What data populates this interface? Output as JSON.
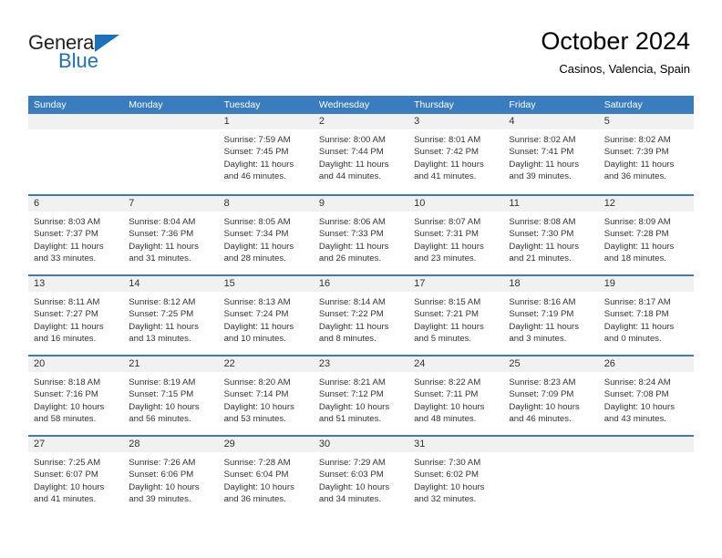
{
  "brand": {
    "name_top": "General",
    "name_bottom": "Blue",
    "triangle_icon": "triangle-icon",
    "color_primary": "#1b72b8",
    "color_text": "#231f20"
  },
  "header": {
    "title": "October 2024",
    "subtitle": "Casinos, Valencia, Spain"
  },
  "calendar": {
    "header_bg": "#3a7dbf",
    "cell_strip_bg": "#f1f1f1",
    "weekdays": [
      "Sunday",
      "Monday",
      "Tuesday",
      "Wednesday",
      "Thursday",
      "Friday",
      "Saturday"
    ],
    "weeks": [
      [
        {
          "day": "",
          "sunrise": "",
          "sunset": "",
          "daylight_line1": "",
          "daylight_line2": ""
        },
        {
          "day": "",
          "sunrise": "",
          "sunset": "",
          "daylight_line1": "",
          "daylight_line2": ""
        },
        {
          "day": "1",
          "sunrise": "Sunrise: 7:59 AM",
          "sunset": "Sunset: 7:45 PM",
          "daylight_line1": "Daylight: 11 hours",
          "daylight_line2": "and 46 minutes."
        },
        {
          "day": "2",
          "sunrise": "Sunrise: 8:00 AM",
          "sunset": "Sunset: 7:44 PM",
          "daylight_line1": "Daylight: 11 hours",
          "daylight_line2": "and 44 minutes."
        },
        {
          "day": "3",
          "sunrise": "Sunrise: 8:01 AM",
          "sunset": "Sunset: 7:42 PM",
          "daylight_line1": "Daylight: 11 hours",
          "daylight_line2": "and 41 minutes."
        },
        {
          "day": "4",
          "sunrise": "Sunrise: 8:02 AM",
          "sunset": "Sunset: 7:41 PM",
          "daylight_line1": "Daylight: 11 hours",
          "daylight_line2": "and 39 minutes."
        },
        {
          "day": "5",
          "sunrise": "Sunrise: 8:02 AM",
          "sunset": "Sunset: 7:39 PM",
          "daylight_line1": "Daylight: 11 hours",
          "daylight_line2": "and 36 minutes."
        }
      ],
      [
        {
          "day": "6",
          "sunrise": "Sunrise: 8:03 AM",
          "sunset": "Sunset: 7:37 PM",
          "daylight_line1": "Daylight: 11 hours",
          "daylight_line2": "and 33 minutes."
        },
        {
          "day": "7",
          "sunrise": "Sunrise: 8:04 AM",
          "sunset": "Sunset: 7:36 PM",
          "daylight_line1": "Daylight: 11 hours",
          "daylight_line2": "and 31 minutes."
        },
        {
          "day": "8",
          "sunrise": "Sunrise: 8:05 AM",
          "sunset": "Sunset: 7:34 PM",
          "daylight_line1": "Daylight: 11 hours",
          "daylight_line2": "and 28 minutes."
        },
        {
          "day": "9",
          "sunrise": "Sunrise: 8:06 AM",
          "sunset": "Sunset: 7:33 PM",
          "daylight_line1": "Daylight: 11 hours",
          "daylight_line2": "and 26 minutes."
        },
        {
          "day": "10",
          "sunrise": "Sunrise: 8:07 AM",
          "sunset": "Sunset: 7:31 PM",
          "daylight_line1": "Daylight: 11 hours",
          "daylight_line2": "and 23 minutes."
        },
        {
          "day": "11",
          "sunrise": "Sunrise: 8:08 AM",
          "sunset": "Sunset: 7:30 PM",
          "daylight_line1": "Daylight: 11 hours",
          "daylight_line2": "and 21 minutes."
        },
        {
          "day": "12",
          "sunrise": "Sunrise: 8:09 AM",
          "sunset": "Sunset: 7:28 PM",
          "daylight_line1": "Daylight: 11 hours",
          "daylight_line2": "and 18 minutes."
        }
      ],
      [
        {
          "day": "13",
          "sunrise": "Sunrise: 8:11 AM",
          "sunset": "Sunset: 7:27 PM",
          "daylight_line1": "Daylight: 11 hours",
          "daylight_line2": "and 16 minutes."
        },
        {
          "day": "14",
          "sunrise": "Sunrise: 8:12 AM",
          "sunset": "Sunset: 7:25 PM",
          "daylight_line1": "Daylight: 11 hours",
          "daylight_line2": "and 13 minutes."
        },
        {
          "day": "15",
          "sunrise": "Sunrise: 8:13 AM",
          "sunset": "Sunset: 7:24 PM",
          "daylight_line1": "Daylight: 11 hours",
          "daylight_line2": "and 10 minutes."
        },
        {
          "day": "16",
          "sunrise": "Sunrise: 8:14 AM",
          "sunset": "Sunset: 7:22 PM",
          "daylight_line1": "Daylight: 11 hours",
          "daylight_line2": "and 8 minutes."
        },
        {
          "day": "17",
          "sunrise": "Sunrise: 8:15 AM",
          "sunset": "Sunset: 7:21 PM",
          "daylight_line1": "Daylight: 11 hours",
          "daylight_line2": "and 5 minutes."
        },
        {
          "day": "18",
          "sunrise": "Sunrise: 8:16 AM",
          "sunset": "Sunset: 7:19 PM",
          "daylight_line1": "Daylight: 11 hours",
          "daylight_line2": "and 3 minutes."
        },
        {
          "day": "19",
          "sunrise": "Sunrise: 8:17 AM",
          "sunset": "Sunset: 7:18 PM",
          "daylight_line1": "Daylight: 11 hours",
          "daylight_line2": "and 0 minutes."
        }
      ],
      [
        {
          "day": "20",
          "sunrise": "Sunrise: 8:18 AM",
          "sunset": "Sunset: 7:16 PM",
          "daylight_line1": "Daylight: 10 hours",
          "daylight_line2": "and 58 minutes."
        },
        {
          "day": "21",
          "sunrise": "Sunrise: 8:19 AM",
          "sunset": "Sunset: 7:15 PM",
          "daylight_line1": "Daylight: 10 hours",
          "daylight_line2": "and 56 minutes."
        },
        {
          "day": "22",
          "sunrise": "Sunrise: 8:20 AM",
          "sunset": "Sunset: 7:14 PM",
          "daylight_line1": "Daylight: 10 hours",
          "daylight_line2": "and 53 minutes."
        },
        {
          "day": "23",
          "sunrise": "Sunrise: 8:21 AM",
          "sunset": "Sunset: 7:12 PM",
          "daylight_line1": "Daylight: 10 hours",
          "daylight_line2": "and 51 minutes."
        },
        {
          "day": "24",
          "sunrise": "Sunrise: 8:22 AM",
          "sunset": "Sunset: 7:11 PM",
          "daylight_line1": "Daylight: 10 hours",
          "daylight_line2": "and 48 minutes."
        },
        {
          "day": "25",
          "sunrise": "Sunrise: 8:23 AM",
          "sunset": "Sunset: 7:09 PM",
          "daylight_line1": "Daylight: 10 hours",
          "daylight_line2": "and 46 minutes."
        },
        {
          "day": "26",
          "sunrise": "Sunrise: 8:24 AM",
          "sunset": "Sunset: 7:08 PM",
          "daylight_line1": "Daylight: 10 hours",
          "daylight_line2": "and 43 minutes."
        }
      ],
      [
        {
          "day": "27",
          "sunrise": "Sunrise: 7:25 AM",
          "sunset": "Sunset: 6:07 PM",
          "daylight_line1": "Daylight: 10 hours",
          "daylight_line2": "and 41 minutes."
        },
        {
          "day": "28",
          "sunrise": "Sunrise: 7:26 AM",
          "sunset": "Sunset: 6:06 PM",
          "daylight_line1": "Daylight: 10 hours",
          "daylight_line2": "and 39 minutes."
        },
        {
          "day": "29",
          "sunrise": "Sunrise: 7:28 AM",
          "sunset": "Sunset: 6:04 PM",
          "daylight_line1": "Daylight: 10 hours",
          "daylight_line2": "and 36 minutes."
        },
        {
          "day": "30",
          "sunrise": "Sunrise: 7:29 AM",
          "sunset": "Sunset: 6:03 PM",
          "daylight_line1": "Daylight: 10 hours",
          "daylight_line2": "and 34 minutes."
        },
        {
          "day": "31",
          "sunrise": "Sunrise: 7:30 AM",
          "sunset": "Sunset: 6:02 PM",
          "daylight_line1": "Daylight: 10 hours",
          "daylight_line2": "and 32 minutes."
        },
        {
          "day": "",
          "sunrise": "",
          "sunset": "",
          "daylight_line1": "",
          "daylight_line2": ""
        },
        {
          "day": "",
          "sunrise": "",
          "sunset": "",
          "daylight_line1": "",
          "daylight_line2": ""
        }
      ]
    ]
  }
}
